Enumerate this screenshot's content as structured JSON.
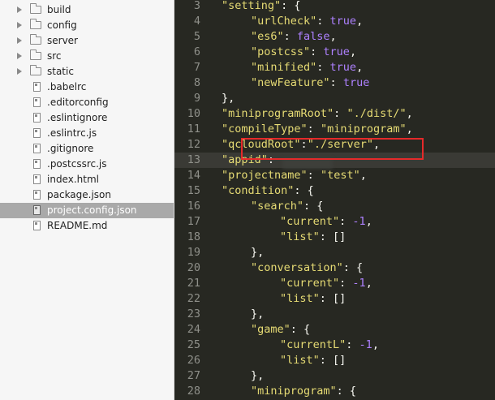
{
  "sidebar": {
    "items": [
      {
        "label": "build",
        "type": "folder"
      },
      {
        "label": "config",
        "type": "folder"
      },
      {
        "label": "server",
        "type": "folder"
      },
      {
        "label": "src",
        "type": "folder"
      },
      {
        "label": "static",
        "type": "folder"
      },
      {
        "label": ".babelrc",
        "type": "file"
      },
      {
        "label": ".editorconfig",
        "type": "file"
      },
      {
        "label": ".eslintignore",
        "type": "file"
      },
      {
        "label": ".eslintrc.js",
        "type": "file"
      },
      {
        "label": ".gitignore",
        "type": "file"
      },
      {
        "label": ".postcssrc.js",
        "type": "file"
      },
      {
        "label": "index.html",
        "type": "file"
      },
      {
        "label": "package.json",
        "type": "file"
      },
      {
        "label": "project.config.json",
        "type": "file",
        "selected": true
      },
      {
        "label": "README.md",
        "type": "file"
      }
    ]
  },
  "editor": {
    "active_line": "13",
    "lines": [
      {
        "num": "3",
        "tokens": [
          [
            "s",
            "\"setting\""
          ],
          [
            "p",
            ": {"
          ]
        ]
      },
      {
        "num": "4",
        "tokens": [
          [
            "s",
            "\"urlCheck\""
          ],
          [
            "p",
            ": "
          ],
          [
            "b",
            "true"
          ],
          [
            "p",
            ","
          ]
        ]
      },
      {
        "num": "5",
        "tokens": [
          [
            "s",
            "\"es6\""
          ],
          [
            "p",
            ": "
          ],
          [
            "b",
            "false"
          ],
          [
            "p",
            ","
          ]
        ]
      },
      {
        "num": "6",
        "tokens": [
          [
            "s",
            "\"postcss\""
          ],
          [
            "p",
            ": "
          ],
          [
            "b",
            "true"
          ],
          [
            "p",
            ","
          ]
        ]
      },
      {
        "num": "7",
        "tokens": [
          [
            "s",
            "\"minified\""
          ],
          [
            "p",
            ": "
          ],
          [
            "b",
            "true"
          ],
          [
            "p",
            ","
          ]
        ]
      },
      {
        "num": "8",
        "tokens": [
          [
            "s",
            "\"newFeature\""
          ],
          [
            "p",
            ": "
          ],
          [
            "b",
            "true"
          ]
        ]
      },
      {
        "num": "9",
        "tokens": [
          [
            "p",
            "},"
          ]
        ]
      },
      {
        "num": "10",
        "tokens": [
          [
            "s",
            "\"miniprogramRoot\""
          ],
          [
            "p",
            ": "
          ],
          [
            "s",
            "\"./dist/\""
          ],
          [
            "p",
            ","
          ]
        ]
      },
      {
        "num": "11",
        "tokens": [
          [
            "s",
            "\"compileType\""
          ],
          [
            "p",
            ": "
          ],
          [
            "s",
            "\"miniprogram\""
          ],
          [
            "p",
            ","
          ]
        ]
      },
      {
        "num": "12",
        "tokens": [
          [
            "s",
            "\"qcloudRoot\""
          ],
          [
            "p",
            ":"
          ],
          [
            "s",
            "\"./server\""
          ],
          [
            "p",
            ","
          ]
        ]
      },
      {
        "num": "13",
        "tokens": [
          [
            "s",
            "\"appid\""
          ],
          [
            "p",
            ": "
          ]
        ]
      },
      {
        "num": "14",
        "tokens": [
          [
            "s",
            "\"projectname\""
          ],
          [
            "p",
            ": "
          ],
          [
            "s",
            "\"test\""
          ],
          [
            "p",
            ","
          ]
        ]
      },
      {
        "num": "15",
        "tokens": [
          [
            "s",
            "\"condition\""
          ],
          [
            "p",
            ": {"
          ]
        ]
      },
      {
        "num": "16",
        "tokens": [
          [
            "s",
            "\"search\""
          ],
          [
            "p",
            ": {"
          ]
        ]
      },
      {
        "num": "17",
        "tokens": [
          [
            "s",
            "\"current\""
          ],
          [
            "p",
            ": "
          ],
          [
            "n",
            "-1"
          ],
          [
            "p",
            ","
          ]
        ]
      },
      {
        "num": "18",
        "tokens": [
          [
            "s",
            "\"list\""
          ],
          [
            "p",
            ": []"
          ]
        ]
      },
      {
        "num": "19",
        "tokens": [
          [
            "p",
            "},"
          ]
        ]
      },
      {
        "num": "20",
        "tokens": [
          [
            "s",
            "\"conversation\""
          ],
          [
            "p",
            ": {"
          ]
        ]
      },
      {
        "num": "21",
        "tokens": [
          [
            "s",
            "\"current\""
          ],
          [
            "p",
            ": "
          ],
          [
            "n",
            "-1"
          ],
          [
            "p",
            ","
          ]
        ]
      },
      {
        "num": "22",
        "tokens": [
          [
            "s",
            "\"list\""
          ],
          [
            "p",
            ": []"
          ]
        ]
      },
      {
        "num": "23",
        "tokens": [
          [
            "p",
            "},"
          ]
        ]
      },
      {
        "num": "24",
        "tokens": [
          [
            "s",
            "\"game\""
          ],
          [
            "p",
            ": {"
          ]
        ]
      },
      {
        "num": "25",
        "tokens": [
          [
            "s",
            "\"currentL\""
          ],
          [
            "p",
            ": "
          ],
          [
            "n",
            "-1"
          ],
          [
            "p",
            ","
          ]
        ]
      },
      {
        "num": "26",
        "tokens": [
          [
            "s",
            "\"list\""
          ],
          [
            "p",
            ": []"
          ]
        ]
      },
      {
        "num": "27",
        "tokens": [
          [
            "p",
            "},"
          ]
        ]
      },
      {
        "num": "28",
        "tokens": [
          [
            "s",
            "\"miniprogram\""
          ],
          [
            "p",
            ": {"
          ]
        ]
      }
    ]
  },
  "annotation": {
    "highlighted_line": "12",
    "color": "#e52a2a"
  }
}
